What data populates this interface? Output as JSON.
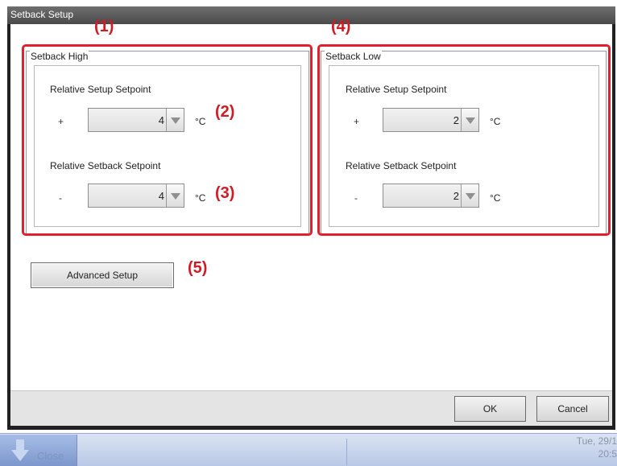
{
  "window": {
    "title": "Setback Setup"
  },
  "setback_high": {
    "title": "Setback High",
    "setup_label": "Relative Setup Setpoint",
    "setup_sign": "+",
    "setup_value": "4",
    "setback_label": "Relative Setback Setpoint",
    "setback_sign": "-",
    "setback_value": "4",
    "unit": "°C"
  },
  "setback_low": {
    "title": "Setback Low",
    "setup_label": "Relative Setup Setpoint",
    "setup_sign": "+",
    "setup_value": "2",
    "setback_label": "Relative Setback Setpoint",
    "setback_sign": "-",
    "setback_value": "2",
    "unit": "°C"
  },
  "advanced_button": "Advanced Setup",
  "footer": {
    "ok": "OK",
    "cancel": "Cancel"
  },
  "callouts": {
    "c1": "(1)",
    "c2": "(2)",
    "c3": "(3)",
    "c4": "(4)",
    "c5": "(5)"
  },
  "taskbar": {
    "close": "Close",
    "date": "Tue, 29/1",
    "time": "20:5"
  },
  "colors": {
    "callout_red": "#e0202c",
    "title_bar": "#4a4a4a",
    "taskbar": "#c8d4ee"
  },
  "icons": {
    "spin_down": "triangle-down-icon",
    "close": "arrow-down-icon"
  }
}
